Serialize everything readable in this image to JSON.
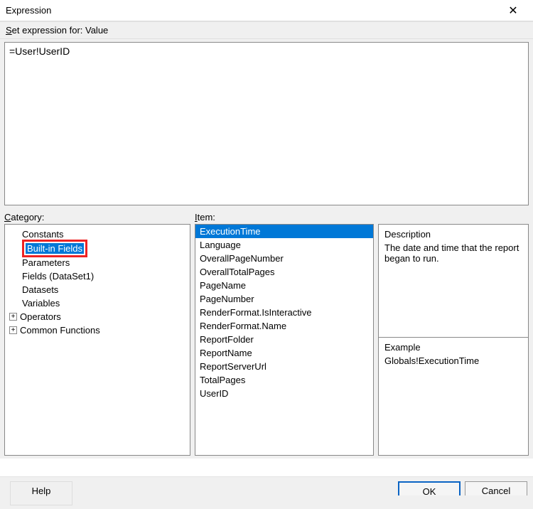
{
  "window": {
    "title": "Expression"
  },
  "labels": {
    "setExpressionPrefix": "Set expression for: ",
    "setExpressionTarget": "Value",
    "category": "Category:",
    "item": "Item:",
    "description": "Description",
    "example": "Example",
    "help": "Help",
    "ok": "OK",
    "cancel": "Cancel"
  },
  "editor": {
    "text": "=User!UserID"
  },
  "category": {
    "items": [
      {
        "label": "Constants",
        "indent": 1,
        "expander": ""
      },
      {
        "label": "Built-in Fields",
        "indent": 1,
        "expander": "",
        "selected": true,
        "highlighted": true
      },
      {
        "label": "Parameters",
        "indent": 1,
        "expander": ""
      },
      {
        "label": "Fields (DataSet1)",
        "indent": 1,
        "expander": ""
      },
      {
        "label": "Datasets",
        "indent": 1,
        "expander": ""
      },
      {
        "label": "Variables",
        "indent": 1,
        "expander": ""
      },
      {
        "label": "Operators",
        "indent": 0,
        "expander": "+"
      },
      {
        "label": "Common Functions",
        "indent": 0,
        "expander": "+"
      }
    ]
  },
  "itemList": {
    "items": [
      {
        "label": "ExecutionTime",
        "selected": true
      },
      {
        "label": "Language"
      },
      {
        "label": "OverallPageNumber"
      },
      {
        "label": "OverallTotalPages"
      },
      {
        "label": "PageName"
      },
      {
        "label": "PageNumber"
      },
      {
        "label": "RenderFormat.IsInteractive"
      },
      {
        "label": "RenderFormat.Name"
      },
      {
        "label": "ReportFolder"
      },
      {
        "label": "ReportName"
      },
      {
        "label": "ReportServerUrl"
      },
      {
        "label": "TotalPages"
      },
      {
        "label": "UserID"
      }
    ]
  },
  "description": {
    "text": "The date and time that the report began to run."
  },
  "example": {
    "text": "Globals!ExecutionTime"
  }
}
